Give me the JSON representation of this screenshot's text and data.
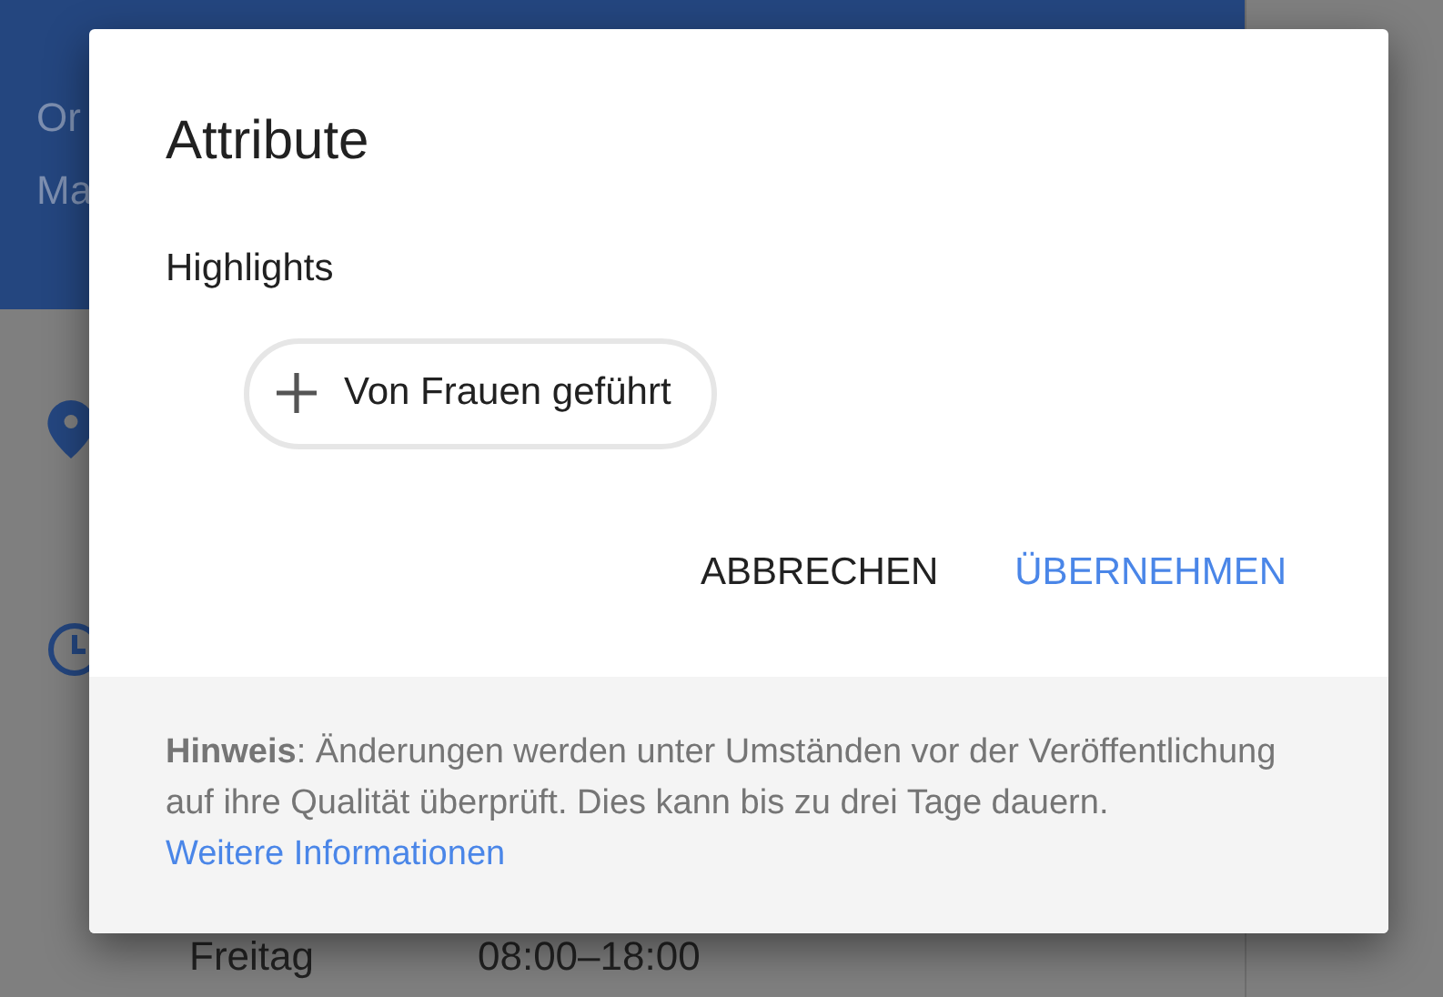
{
  "background": {
    "header_lines": [
      "Or",
      "Ma"
    ],
    "hours_row": {
      "day": "Freitag",
      "time": "08:00–18:00"
    }
  },
  "dialog": {
    "title": "Attribute",
    "section": "Highlights",
    "chips": [
      {
        "label": "Von Frauen geführt",
        "selected": false
      }
    ],
    "buttons": [
      {
        "label": "ABBRECHEN",
        "kind": "secondary"
      },
      {
        "label": "ÜBERNEHMEN",
        "kind": "primary"
      }
    ],
    "note": {
      "text": "**Hinweis**: Änderungen werden unter Umständen vor der Veröffentlichung auf ihre Qualität überprüft. Dies kann bis zu drei Tage dauern.",
      "link": "Weitere Informationen"
    }
  }
}
